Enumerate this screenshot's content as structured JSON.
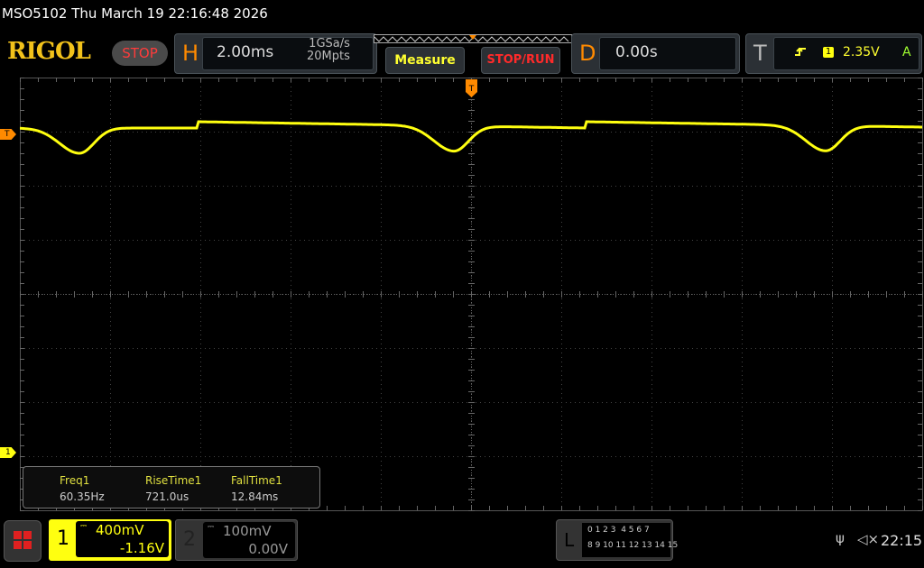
{
  "title": "MSO5102  Thu March 19 22:16:48 2026",
  "logo": "RIGOL",
  "run_state": "STOP",
  "horizontal": {
    "letter": "H",
    "timebase": "2.00ms",
    "sample_rate": "1GSa/s",
    "memory_depth": "20Mpts"
  },
  "buttons": {
    "measure": "Measure",
    "stop_run": "STOP/RUN"
  },
  "delay": {
    "letter": "D",
    "value": "0.00s"
  },
  "trigger": {
    "letter": "T",
    "slope_icon": "rising-edge-icon",
    "source": "1",
    "level": "2.35V",
    "mode": "A"
  },
  "markers": {
    "trigger_level": "T",
    "channel1": "1",
    "trigger_position": "T"
  },
  "measurements": [
    {
      "label": "Freq1",
      "value": "60.35Hz"
    },
    {
      "label": "RiseTime1",
      "value": "721.0us"
    },
    {
      "label": "FallTime1",
      "value": "12.84ms"
    }
  ],
  "channels": [
    {
      "number": "1",
      "scale": "400mV",
      "offset": "-1.16V",
      "coupling_icon": "dc-coupling-icon",
      "active": true
    },
    {
      "number": "2",
      "scale": "100mV",
      "offset": "0.00V",
      "coupling_icon": "dc-coupling-icon",
      "active": false
    }
  ],
  "logic": {
    "letter": "L",
    "row1": "0 1 2 3  4 5 6 7",
    "row2": "8 9 10 11 12 13 14 15"
  },
  "status": {
    "usb_icon": "usb-icon",
    "sound_icon": "mute-icon",
    "clock": "22:15"
  },
  "colors": {
    "ch1": "#ffff10",
    "ch2": "#9aa0a6",
    "accent": "#ff8a00",
    "stop": "#ff3b3b"
  }
}
